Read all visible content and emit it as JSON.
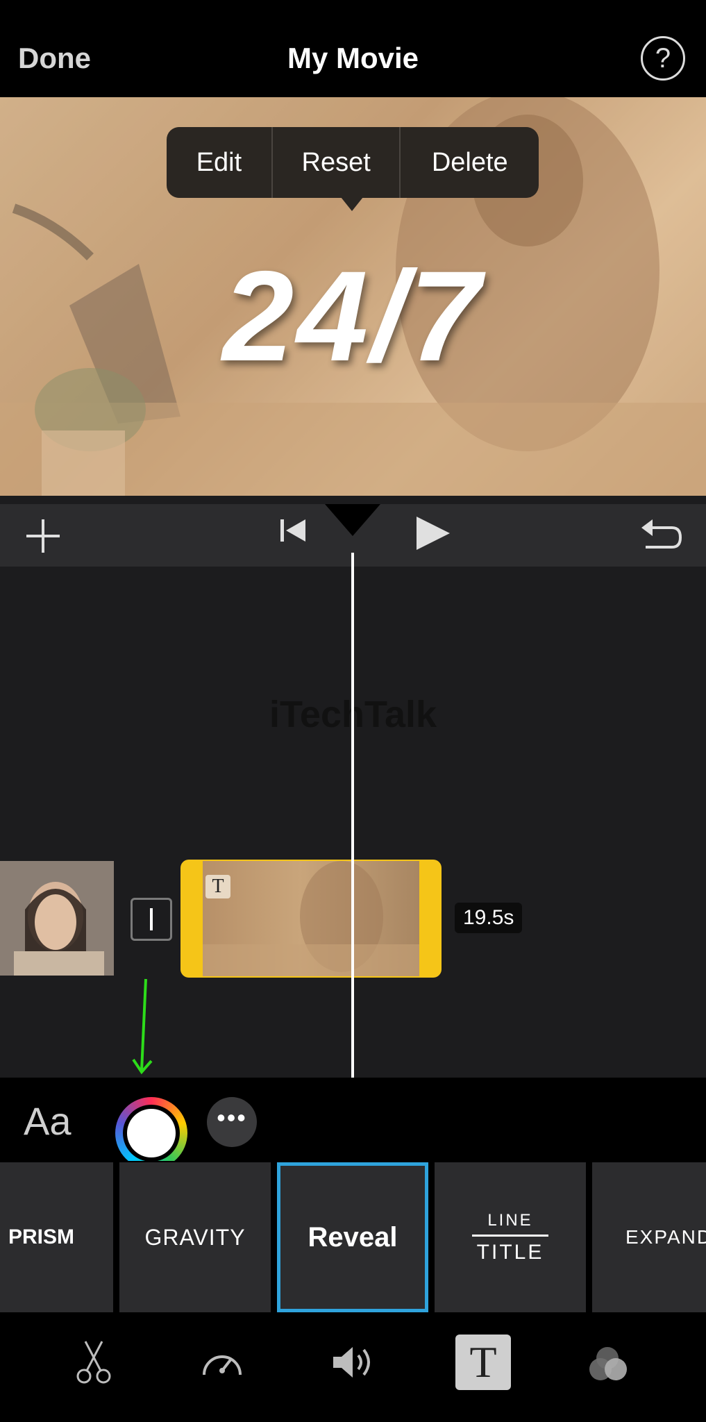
{
  "header": {
    "done_label": "Done",
    "title": "My Movie",
    "help_label": "?"
  },
  "preview": {
    "context_menu": [
      "Edit",
      "Reset",
      "Delete"
    ],
    "title_text": "24/7"
  },
  "timeline": {
    "watermark": "iTechTalk",
    "title_clip_badge": "T",
    "duration": "19.5s"
  },
  "title_options": {
    "font_label": "Aa",
    "more_label": "•••"
  },
  "title_styles": [
    "PRISM",
    "GRAVITY",
    "Reveal",
    "LINE",
    "TITLE",
    "EXPAND"
  ],
  "selected_style": "Reveal",
  "toolbar": {
    "active_tool": "text-icon",
    "icons": [
      "scissors-icon",
      "speed-icon",
      "volume-icon",
      "text-icon",
      "filters-icon"
    ]
  },
  "colors": {
    "accent": "#2fa3dc",
    "clip_highlight": "#f5c518",
    "arrow": "#2ddc1a"
  }
}
